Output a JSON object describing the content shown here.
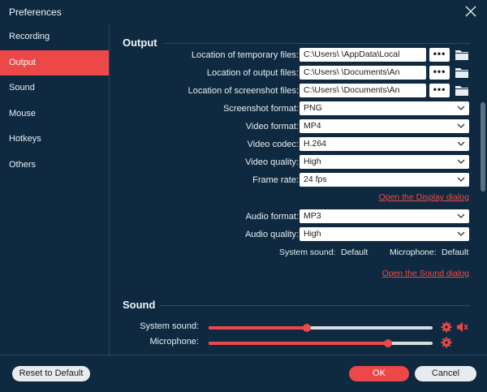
{
  "window": {
    "title": "Preferences"
  },
  "sidebar": {
    "items": [
      {
        "label": "Recording"
      },
      {
        "label": "Output"
      },
      {
        "label": "Sound"
      },
      {
        "label": "Mouse"
      },
      {
        "label": "Hotkeys"
      },
      {
        "label": "Others"
      }
    ],
    "active": "Output"
  },
  "output": {
    "title": "Output",
    "temp_label": "Location of temporary files:",
    "temp_path": "C:\\Users\\            \\AppData\\Local",
    "out_label": "Location of output files:",
    "out_path": "C:\\Users\\            \\Documents\\An",
    "shot_label": "Location of screenshot files:",
    "shot_path": "C:\\Users\\            \\Documents\\An",
    "dots": "•••",
    "screenshot_format_label": "Screenshot format:",
    "screenshot_format": "PNG",
    "video_format_label": "Video format:",
    "video_format": "MP4",
    "video_codec_label": "Video codec:",
    "video_codec": "H.264",
    "video_quality_label": "Video quality:",
    "video_quality": "High",
    "frame_rate_label": "Frame rate:",
    "frame_rate": "24 fps",
    "display_link": "Open the Display dialog",
    "audio_format_label": "Audio format:",
    "audio_format": "MP3",
    "audio_quality_label": "Audio quality:",
    "audio_quality": "High",
    "system_sound_info": "System sound:",
    "system_sound_value": "Default",
    "microphone_info": "Microphone:",
    "microphone_value": "Default",
    "sound_link": "Open the Sound dialog"
  },
  "sound": {
    "title": "Sound",
    "system_label": "System sound:",
    "system_level": 0.44,
    "mic_label": "Microphone:",
    "mic_level": 0.8
  },
  "footer": {
    "reset": "Reset to Default",
    "ok": "OK",
    "cancel": "Cancel"
  },
  "colors": {
    "accent": "#ec4848",
    "background": "#0f2a40"
  },
  "icons": {
    "close": "close-icon",
    "folder": "folder-icon",
    "dropdown": "chevron-down-icon",
    "gear": "gear-icon",
    "speaker": "speaker-icon"
  }
}
